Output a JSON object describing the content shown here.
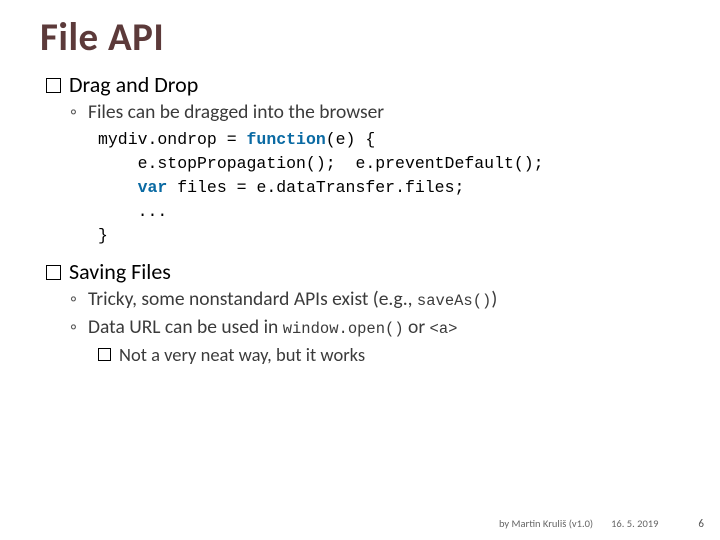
{
  "title": "File API",
  "section1": {
    "heading": "Drag and Drop",
    "bullet1": "Files can be dragged into the browser",
    "code": {
      "l1a": "mydiv.ondrop = ",
      "l1_kw": "function",
      "l1b": "(e) {",
      "l2": "    e.stopPropagation();  e.preventDefault();",
      "l3a": "    ",
      "l3_kw": "var",
      "l3b": " files = e.dataTransfer.files;",
      "l4": "    ...",
      "l5": "}"
    }
  },
  "section2": {
    "heading": "Saving Files",
    "bullet1_a": "Tricky, some nonstandard APIs exist (e.g., ",
    "bullet1_code": "saveAs()",
    "bullet1_b": ")",
    "bullet2_a": "Data URL can be used in ",
    "bullet2_code": "window.open()",
    "bullet2_b": " or ",
    "bullet2_code2": "<a>",
    "sub1": "Not a very neat way, but it works"
  },
  "footer": {
    "author": "by Martin Kruliš (v1.0)",
    "date": "16. 5. 2019",
    "page": "6"
  }
}
